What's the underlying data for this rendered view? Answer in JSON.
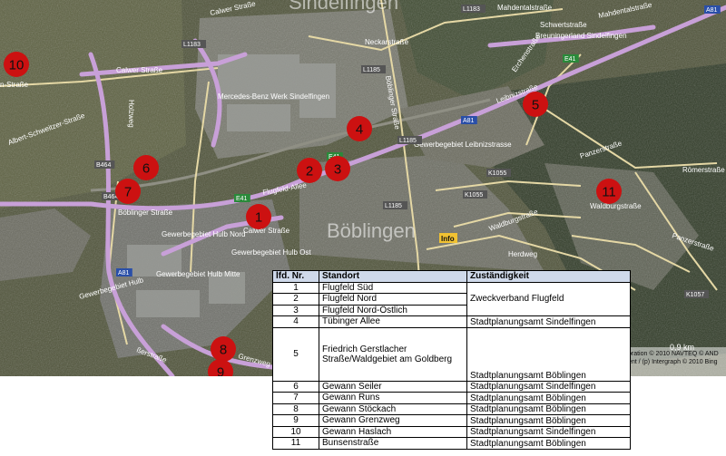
{
  "map": {
    "city_labels": [
      {
        "id": "sindelfingen",
        "text": "Sindelfingen"
      },
      {
        "id": "boeblingen",
        "text": "Böblingen"
      }
    ],
    "street_labels": [
      {
        "id": "calwer-strasse-1",
        "text": "Calwer Straße"
      },
      {
        "id": "calwer-strasse-2",
        "text": "Calwer Straße"
      },
      {
        "id": "calwer-strasse-3",
        "text": "Calwer Straße"
      },
      {
        "id": "neckarstrasse",
        "text": "Neckarstraße"
      },
      {
        "id": "mahdentalstrasse",
        "text": "Mahdentalstraße"
      },
      {
        "id": "mahdentalstrasse-2",
        "text": "Mahdentalstraße"
      },
      {
        "id": "schwertstrasse",
        "text": "Schwertstraße"
      },
      {
        "id": "breuningerland",
        "text": "Breuningerland Sindelfingen"
      },
      {
        "id": "mercedes",
        "text": "Mercedes-Benz Werk Sindelfingen"
      },
      {
        "id": "boeblinger-strasse-1",
        "text": "Böblinger Straße"
      },
      {
        "id": "boeblinger-strasse-2",
        "text": "Böblinger Straße"
      },
      {
        "id": "flugfeld-allee",
        "text": "Flugfeld-Allee"
      },
      {
        "id": "gewerbegebiet-leibniz",
        "text": "Gewerbegebiet Leibnizstrasse"
      },
      {
        "id": "leibnizstrasse",
        "text": "Leibnizstraße"
      },
      {
        "id": "panzerstrasse",
        "text": "Panzerstraße"
      },
      {
        "id": "panzerstrasse-2",
        "text": "Panzerstraße"
      },
      {
        "id": "roemerstrasse",
        "text": "Römerstraße"
      },
      {
        "id": "waldburgstrasse",
        "text": "Waldburgstraße"
      },
      {
        "id": "waldburgstrasse-2",
        "text": "Waldburgstraße"
      },
      {
        "id": "herdweg",
        "text": "Herdweg"
      },
      {
        "id": "gewerbegebiet-hulb-nord",
        "text": "Gewerbegebiet Hulb Nord"
      },
      {
        "id": "gewerbegebiet-hulb-ost",
        "text": "Gewerbegebiet Hulb Ost"
      },
      {
        "id": "gewerbegebiet-hulb-mitte",
        "text": "Gewerbegebiet Hulb Mitte"
      },
      {
        "id": "gewerbegebiet-hulb",
        "text": "Gewerbegebiet Hulb"
      },
      {
        "id": "grenzweg",
        "text": "Grenzweg"
      },
      {
        "id": "albert-schweitzer",
        "text": "Albert-Schweitzer-Straße"
      },
      {
        "id": "holzweg",
        "text": "Holzweg"
      },
      {
        "id": "herrenberger",
        "text": "ßerstraße"
      },
      {
        "id": "erchenstrasse",
        "text": "Erchenstraße"
      },
      {
        "id": "info",
        "text": "Info"
      },
      {
        "id": "str-left",
        "text": "n-Straße"
      }
    ],
    "shields": [
      {
        "id": "l1183-a",
        "text": "L1183"
      },
      {
        "id": "l1183-b",
        "text": "L1183"
      },
      {
        "id": "l1185-a",
        "text": "L1185"
      },
      {
        "id": "l1185-b",
        "text": "L1185"
      },
      {
        "id": "l1185-c",
        "text": "L1185"
      },
      {
        "id": "a81-a",
        "text": "A81"
      },
      {
        "id": "a81-b",
        "text": "A81"
      },
      {
        "id": "a81-c",
        "text": "A81"
      },
      {
        "id": "e41-a",
        "text": "E41"
      },
      {
        "id": "e41-b",
        "text": "E41"
      },
      {
        "id": "e41-c",
        "text": "E41"
      },
      {
        "id": "b464-a",
        "text": "B464"
      },
      {
        "id": "b464-b",
        "text": "B464"
      },
      {
        "id": "k1055-a",
        "text": "K1055"
      },
      {
        "id": "k1055-b",
        "text": "K1055"
      },
      {
        "id": "k1057",
        "text": "K1057"
      }
    ],
    "markers": [
      {
        "id": "1",
        "label": "1"
      },
      {
        "id": "2",
        "label": "2"
      },
      {
        "id": "3",
        "label": "3"
      },
      {
        "id": "4",
        "label": "4"
      },
      {
        "id": "5",
        "label": "5"
      },
      {
        "id": "6",
        "label": "6"
      },
      {
        "id": "7",
        "label": "7"
      },
      {
        "id": "8",
        "label": "8"
      },
      {
        "id": "9",
        "label": "9"
      },
      {
        "id": "10",
        "label": "10"
      },
      {
        "id": "11",
        "label": "11"
      }
    ],
    "scale": "0,9 km",
    "credit": {
      "line1": "oration   © 2010 NAVTEQ   © AND",
      "line2": "ent / (p) Intergraph   © 2010 Bing"
    },
    "colors": {
      "marker_fill": "#cc1111",
      "highway": "#c69ed4",
      "road": "#e8d9a8",
      "dark": "#3b3e2f"
    }
  },
  "table": {
    "headers": {
      "nr": "lfd. Nr.",
      "standort": "Standort",
      "zustaendigkeit": "Zuständigkeit"
    },
    "rows": [
      {
        "nr": "1",
        "standort": "Flugfeld Süd"
      },
      {
        "nr": "2",
        "standort": "Flugfeld Nord",
        "zustaendigkeit": "Zweckverband Flugfeld"
      },
      {
        "nr": "3",
        "standort": "Flugfeld Nord-Östlich"
      },
      {
        "nr": "4",
        "standort": "Tübinger Allee",
        "zustaendigkeit": "Stadtplanungsamt Sindelfingen"
      },
      {
        "nr": "5",
        "standort": "Friedrich Gerstlacher Straße/Waldgebiet am Goldberg",
        "zustaendigkeit": "Stadtplanungsamt Böblingen"
      },
      {
        "nr": "6",
        "standort": "Gewann Seiler",
        "zustaendigkeit": "Stadtplanungsamt Sindelfingen"
      },
      {
        "nr": "7",
        "standort": "Gewann Runs",
        "zustaendigkeit": "Stadtplanungsamt Böblingen"
      },
      {
        "nr": "8",
        "standort": "Gewann Stöckach",
        "zustaendigkeit": "Stadtplanungsamt Böblingen"
      },
      {
        "nr": "9",
        "standort": "Gewann Grenzweg",
        "zustaendigkeit": "Stadtplanungsamt Böblingen"
      },
      {
        "nr": "10",
        "standort": "Gewann Haslach",
        "zustaendigkeit": "Stadtplanungsamt Sindelfingen"
      },
      {
        "nr": "11",
        "standort": "Bunsenstraße",
        "zustaendigkeit": "Stadtplanungsamt Böblingen"
      }
    ]
  }
}
